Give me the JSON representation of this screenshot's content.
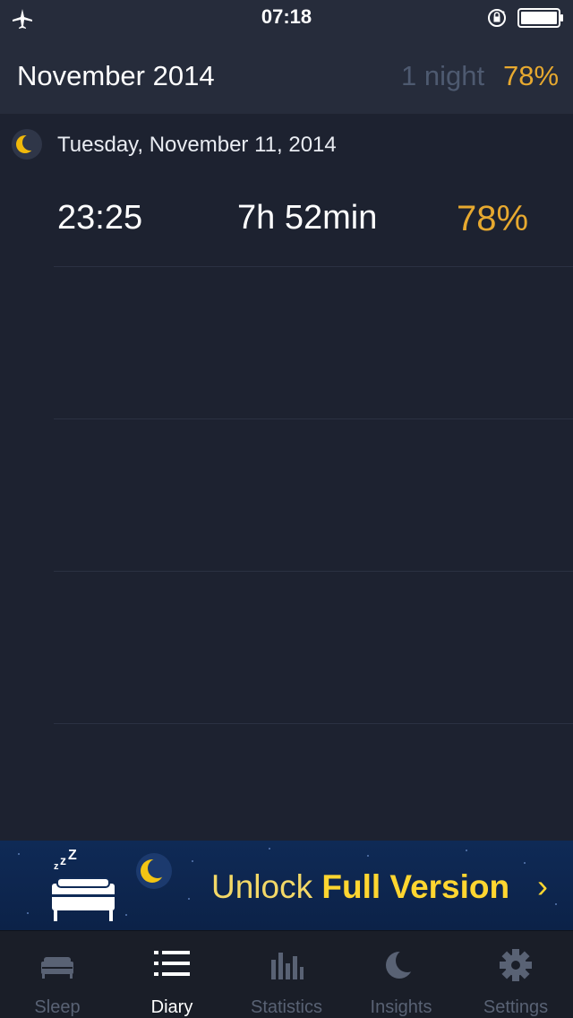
{
  "status_bar": {
    "time": "07:18",
    "icons": [
      "airplane-mode-icon",
      "rotation-lock-icon",
      "battery-icon"
    ]
  },
  "header": {
    "title": "November 2014",
    "nights": "1 night",
    "quality": "78%"
  },
  "diary": {
    "entries": [
      {
        "date": "Tuesday, November 11, 2014",
        "start": "23:25",
        "duration": "7h 52min",
        "quality": "78%",
        "icon": "moon-icon"
      }
    ]
  },
  "banner": {
    "text_prefix": "Unlock ",
    "text_emphasis": "Full Version",
    "chevron": "›",
    "icons": [
      "bed-zzz-icon",
      "moon-icon"
    ]
  },
  "tabs": [
    {
      "label": "Sleep",
      "icon": "bed-icon",
      "active": false
    },
    {
      "label": "Diary",
      "icon": "list-icon",
      "active": true
    },
    {
      "label": "Statistics",
      "icon": "bar-chart-icon",
      "active": false
    },
    {
      "label": "Insights",
      "icon": "crescent-moon-icon",
      "active": false
    },
    {
      "label": "Settings",
      "icon": "gear-icon",
      "active": false
    }
  ],
  "colors": {
    "background": "#1d2230",
    "header_background": "#262c3b",
    "accent": "#e7a92f",
    "banner_background": "#0f2a56",
    "banner_text": "#ffd630"
  }
}
